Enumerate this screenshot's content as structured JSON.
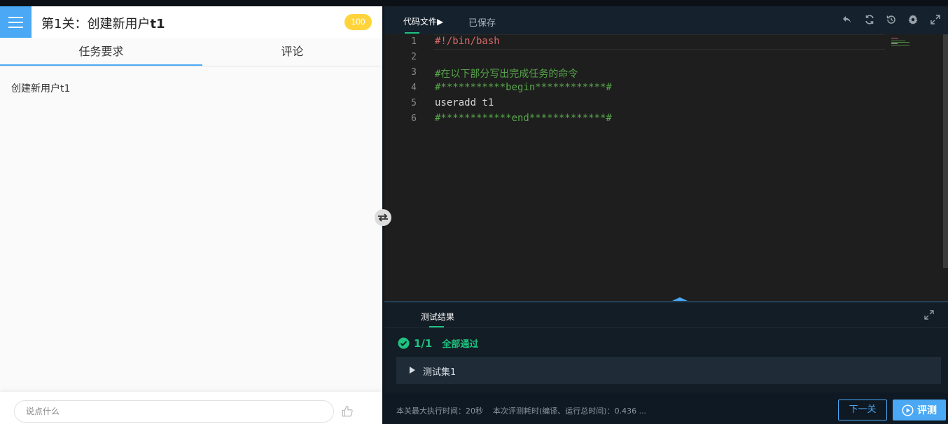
{
  "header": {
    "title_prefix": "第1关：创建新用户",
    "title_bold": "t1",
    "score": "100"
  },
  "tabs": [
    {
      "label": "任务要求",
      "active": true
    },
    {
      "label": "评论",
      "active": false
    }
  ],
  "task": {
    "text": "创建新用户t1"
  },
  "comment": {
    "placeholder": "说点什么"
  },
  "editor": {
    "file_tab_label": "代码文件▶",
    "saved_label": "已保存",
    "toolbar_icons": [
      "undo-icon",
      "refresh-icon",
      "restore-icon",
      "settings-icon",
      "fullscreen-icon"
    ],
    "lines": [
      {
        "num": "1",
        "text": "#!/bin/bash",
        "kind": "shebang"
      },
      {
        "num": "2",
        "text": "",
        "kind": "plain"
      },
      {
        "num": "3",
        "text": "#在以下部分写出完成任务的命令",
        "kind": "comment"
      },
      {
        "num": "4",
        "text": "#***********begin************#",
        "kind": "comment"
      },
      {
        "num": "5",
        "text": "useradd t1",
        "kind": "plain"
      },
      {
        "num": "6",
        "text": "#************end*************#",
        "kind": "comment"
      }
    ]
  },
  "results": {
    "tab_label": "测试结果",
    "pass_count": "1/1",
    "pass_text": "全部通过",
    "testset_label": "测试集1"
  },
  "footer": {
    "max_time": "本关最大执行时间：20秒",
    "eval_time": "本次评测耗时(编译、运行总时间)：0.436 ...",
    "next_label": "下一关",
    "eval_label": "评测"
  },
  "colors": {
    "accent": "#4aa8f4",
    "success": "#1fc37f",
    "badge": "#ffd43b",
    "editor_bg": "#1e1e1e"
  }
}
